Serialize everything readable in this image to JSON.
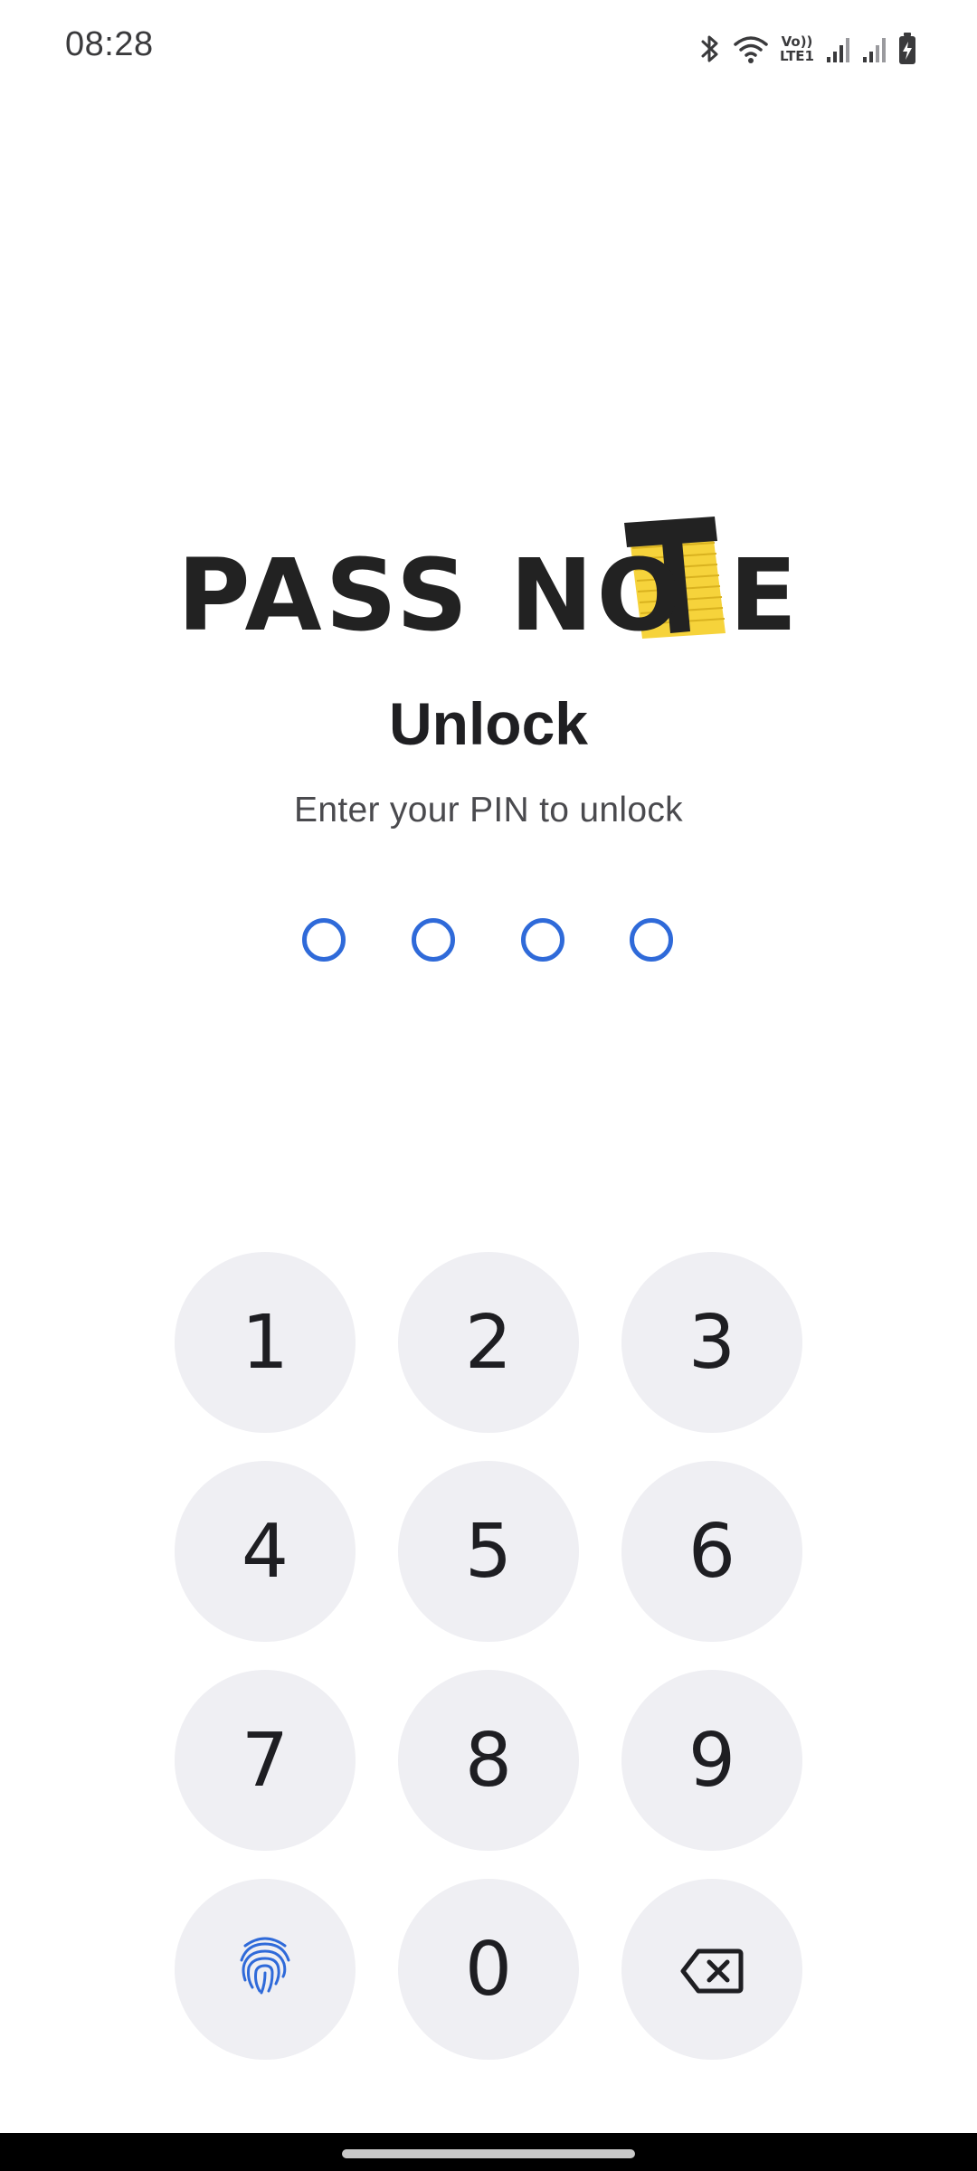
{
  "status_bar": {
    "time": "08:28",
    "icons": [
      "bluetooth-icon",
      "wifi-icon",
      "volte-indicator",
      "signal-icon",
      "signal-icon",
      "battery-charging-icon"
    ],
    "volte_line1": "Vo))",
    "volte_line2": "LTE1"
  },
  "logo": {
    "text": "PASS NOTE",
    "colors": {
      "text": "#222222",
      "accent": "#f6d33b"
    }
  },
  "unlock": {
    "title": "Unlock",
    "subtitle": "Enter your PIN to unlock"
  },
  "pin": {
    "length": 4,
    "filled": 0,
    "color": "#2f6ad9"
  },
  "keypad": {
    "keys": [
      "1",
      "2",
      "3",
      "4",
      "5",
      "6",
      "7",
      "8",
      "9",
      "fingerprint-icon",
      "0",
      "backspace-icon"
    ],
    "key_background": "#efeff3"
  }
}
